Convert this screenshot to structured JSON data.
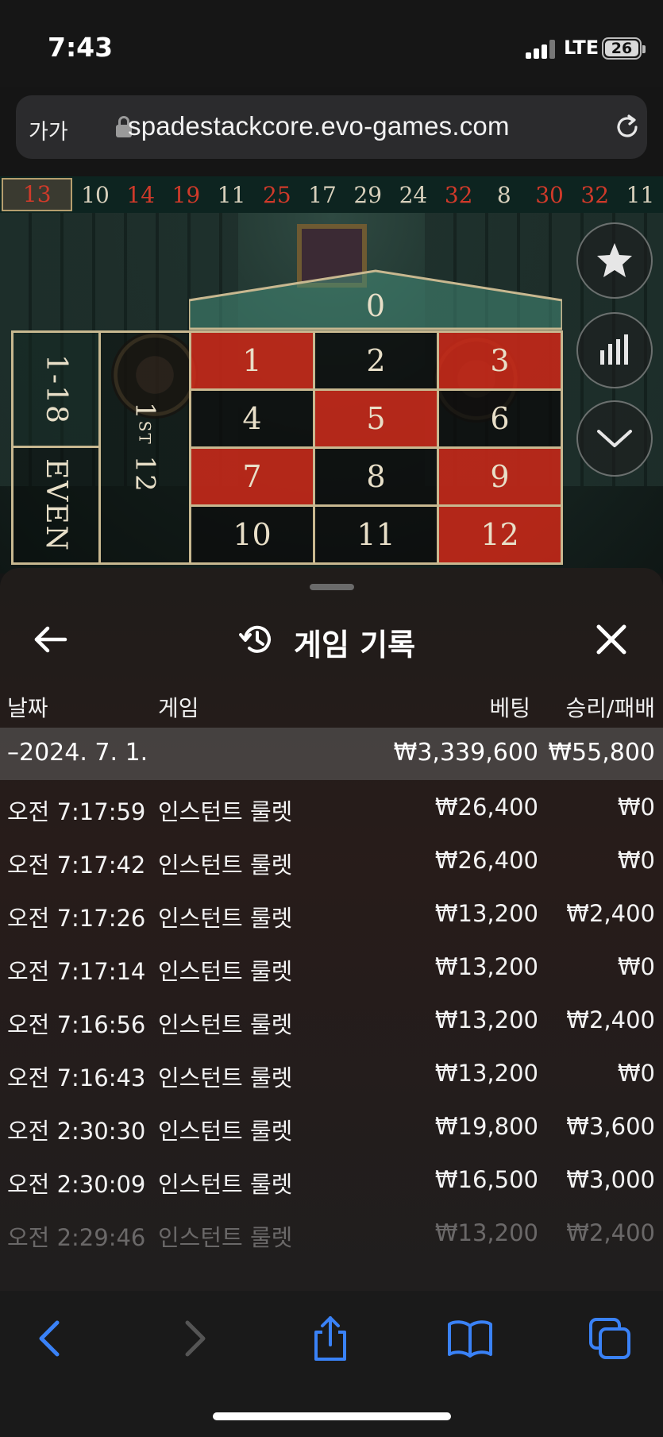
{
  "status_bar": {
    "time": "7:43",
    "network": "LTE",
    "battery": "26"
  },
  "browser": {
    "text_size_label": "가가",
    "url": "spadestackcore.evo-games.com"
  },
  "recent_numbers": [
    {
      "value": "13",
      "color": "red",
      "current": true
    },
    {
      "value": "10",
      "color": "black"
    },
    {
      "value": "14",
      "color": "red"
    },
    {
      "value": "19",
      "color": "red"
    },
    {
      "value": "11",
      "color": "black"
    },
    {
      "value": "25",
      "color": "red"
    },
    {
      "value": "17",
      "color": "black"
    },
    {
      "value": "29",
      "color": "black"
    },
    {
      "value": "24",
      "color": "black"
    },
    {
      "value": "32",
      "color": "red"
    },
    {
      "value": "8",
      "color": "black"
    },
    {
      "value": "30",
      "color": "red"
    },
    {
      "value": "32",
      "color": "red"
    },
    {
      "value": "11",
      "color": "black"
    }
  ],
  "board": {
    "zero": "0",
    "side_labels": {
      "low": "1-18",
      "even": "EVEN",
      "dozen": "1ST 12"
    },
    "dozen_sup": "ST",
    "dozen_prefix": "1",
    "dozen_suffix": "12",
    "numbers": [
      {
        "n": "1",
        "color": "red"
      },
      {
        "n": "2",
        "color": "black"
      },
      {
        "n": "3",
        "color": "red"
      },
      {
        "n": "4",
        "color": "black"
      },
      {
        "n": "5",
        "color": "red"
      },
      {
        "n": "6",
        "color": "black"
      },
      {
        "n": "7",
        "color": "red"
      },
      {
        "n": "8",
        "color": "black"
      },
      {
        "n": "9",
        "color": "red"
      },
      {
        "n": "10",
        "color": "black"
      },
      {
        "n": "11",
        "color": "black"
      },
      {
        "n": "12",
        "color": "red"
      }
    ]
  },
  "panel": {
    "title": "게임 기록",
    "columns": {
      "date": "날짜",
      "game": "게임",
      "bet": "베팅",
      "win_loss": "승리/패배"
    },
    "summary": {
      "date": "–2024. 7. 1.",
      "bet": "₩3,339,600",
      "win_loss": "₩55,800"
    },
    "rows": [
      {
        "time": "오전 7:17:59",
        "game": "인스턴트 룰렛",
        "bet": "₩26,400",
        "win": "₩0"
      },
      {
        "time": "오전 7:17:42",
        "game": "인스턴트 룰렛",
        "bet": "₩26,400",
        "win": "₩0"
      },
      {
        "time": "오전 7:17:26",
        "game": "인스턴트 룰렛",
        "bet": "₩13,200",
        "win": "₩2,400"
      },
      {
        "time": "오전 7:17:14",
        "game": "인스턴트 룰렛",
        "bet": "₩13,200",
        "win": "₩0"
      },
      {
        "time": "오전 7:16:56",
        "game": "인스턴트 룰렛",
        "bet": "₩13,200",
        "win": "₩2,400"
      },
      {
        "time": "오전 7:16:43",
        "game": "인스턴트 룰렛",
        "bet": "₩13,200",
        "win": "₩0"
      },
      {
        "time": "오전 2:30:30",
        "game": "인스턴트 룰렛",
        "bet": "₩19,800",
        "win": "₩3,600"
      },
      {
        "time": "오전 2:30:09",
        "game": "인스턴트 룰렛",
        "bet": "₩16,500",
        "win": "₩3,000"
      },
      {
        "time": "오전 2:29:46",
        "game": "인스턴트 룰렛",
        "bet": "₩13,200",
        "win": "₩2,400"
      }
    ]
  },
  "colors": {
    "red": "#c42818",
    "black": "#0c0c0c",
    "accent": "#3a82f7",
    "gold": "#c8b890"
  }
}
